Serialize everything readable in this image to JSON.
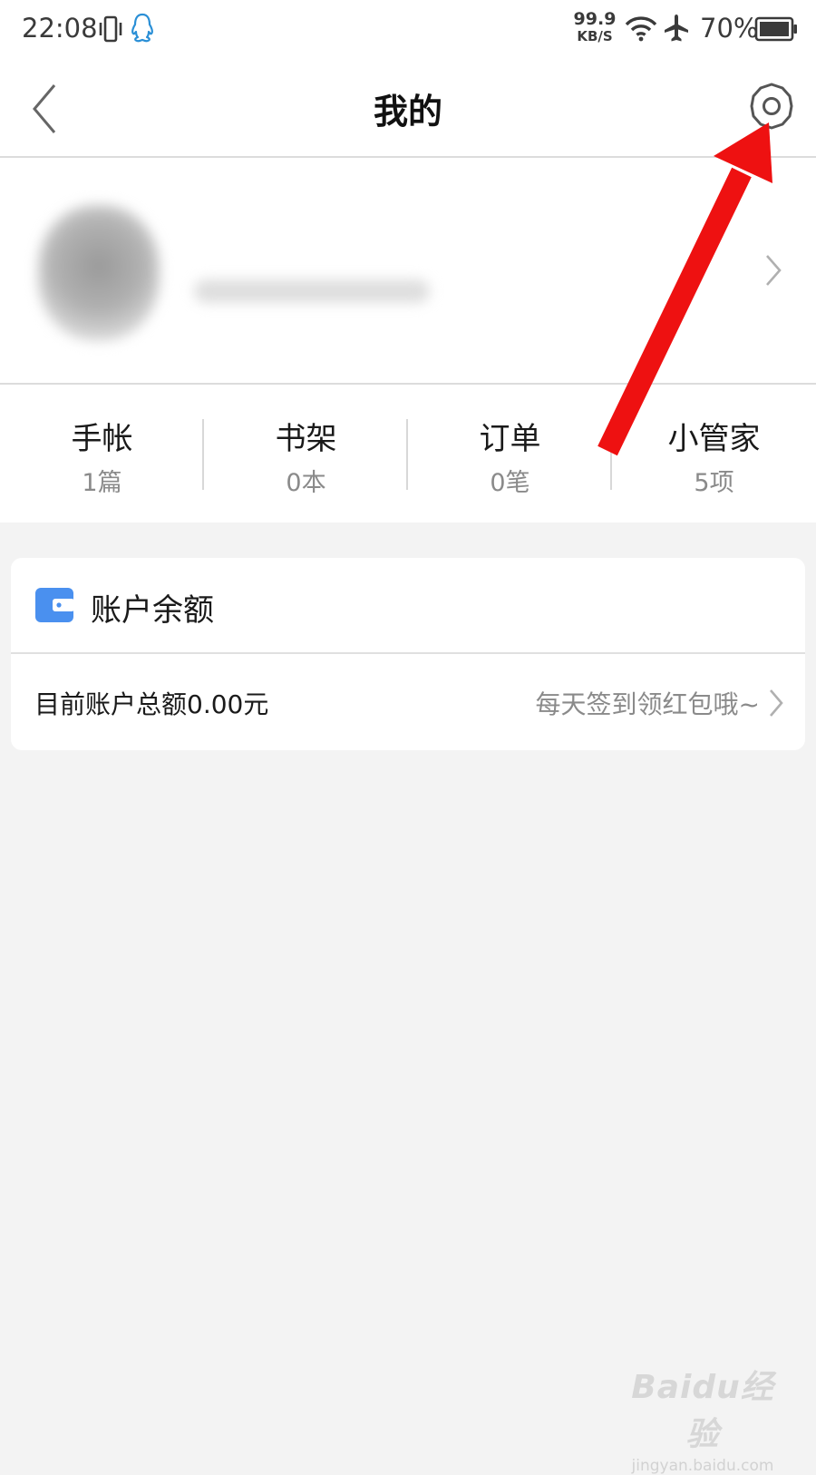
{
  "status_bar": {
    "time": "22:08",
    "net_speed_value": "99.9",
    "net_speed_unit": "KB/S",
    "battery_percent": "70%",
    "icons": [
      "vibrate-icon",
      "qq-icon",
      "wifi-icon",
      "airplane-icon",
      "battery-icon"
    ]
  },
  "nav": {
    "title": "我的",
    "back_icon": "back-chevron-icon",
    "settings_icon": "gear-icon"
  },
  "profile": {
    "avatar": "blurred",
    "nickname": "blurred",
    "chevron_icon": "chevron-right-icon"
  },
  "stats": [
    {
      "label": "手帐",
      "value": "1篇"
    },
    {
      "label": "书架",
      "value": "0本"
    },
    {
      "label": "订单",
      "value": "0笔"
    },
    {
      "label": "小管家",
      "value": "5项"
    }
  ],
  "balance": {
    "title": "账户余额",
    "amount_text": "目前账户总额0.00元",
    "hint": "每天签到领红包哦~",
    "icon": "wallet-icon"
  },
  "watermark": {
    "brand": "Baidu经验",
    "url": "jingyan.baidu.com"
  },
  "colors": {
    "background": "#f3f3f3",
    "card": "#ffffff",
    "wallet_blue": "#4a90ef",
    "annotation_red": "#ee1111",
    "secondary_text": "#8a8a8a"
  }
}
